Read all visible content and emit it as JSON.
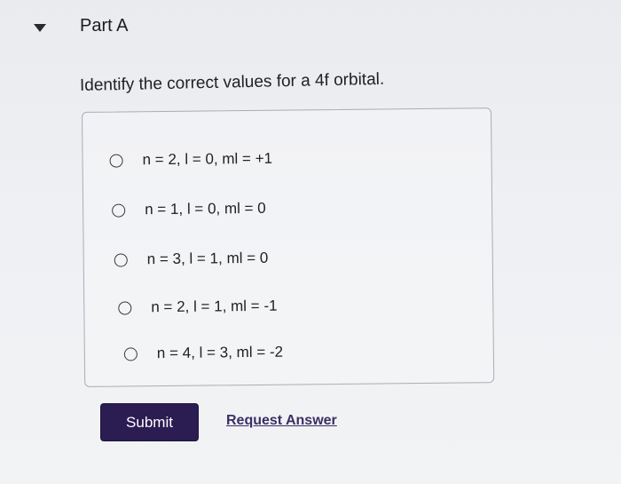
{
  "part": {
    "title": "Part A",
    "caret_icon": "caret-down-icon"
  },
  "question": "Identify the correct values for a 4f orbital.",
  "options": [
    {
      "label": "n = 2, l = 0, ml = +1"
    },
    {
      "label": "n = 1, l = 0, ml = 0"
    },
    {
      "label": "n = 3, l = 1, ml = 0"
    },
    {
      "label": "n = 2, l = 1, ml = -1"
    },
    {
      "label": "n = 4, l = 3, ml = -2"
    }
  ],
  "actions": {
    "submit_label": "Submit",
    "request_answer_label": "Request Answer"
  },
  "colors": {
    "submit_bg": "#2b1d52",
    "link": "#3b2f63"
  }
}
